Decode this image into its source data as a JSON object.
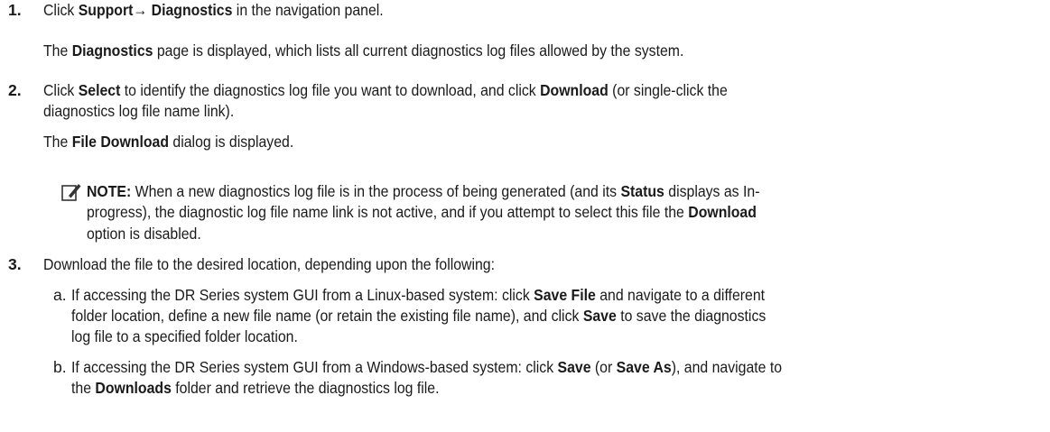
{
  "steps": [
    {
      "number": "1.",
      "line": [
        "Click ",
        "Support",
        "→ ",
        "Diagnostics",
        " in the navigation panel."
      ],
      "result": [
        "The ",
        "Diagnostics",
        " page is displayed, which lists all current diagnostics log files allowed by the system."
      ]
    },
    {
      "number": "2.",
      "line1": [
        "Click ",
        "Select",
        " to identify the diagnostics log file you want to download, and click ",
        "Download",
        " (or single-click the"
      ],
      "line2": "diagnostics log file name link).",
      "result": [
        "The ",
        "File Download",
        " dialog is displayed."
      ]
    },
    {
      "number": "3.",
      "line": "Download the file to the desired location, depending upon the following:"
    }
  ],
  "note": {
    "icon": "note-pencil-icon",
    "label": "NOTE:",
    "line1": [
      " When a new diagnostics log file is in the process of being generated (and its ",
      "Status",
      " displays as In-"
    ],
    "line2": "progress), the diagnostic log file name link is not active, and if you attempt to select this file the ",
    "line2_bold": "Download",
    "line3": "option is disabled."
  },
  "substeps": [
    {
      "letter": "a.",
      "line1": [
        "If accessing the DR Series system GUI from a Linux-based system: click ",
        "Save File",
        " and navigate to a different"
      ],
      "line2": "folder location, define a new file name (or retain the existing file name), and click ",
      "line2_bold": "Save",
      "line2_tail": " to save the diagnostics",
      "line3": "log file to a specified folder location."
    },
    {
      "letter": "b.",
      "line1": [
        "If accessing the DR Series system GUI from a Windows-based system: click ",
        "Save",
        " (or ",
        "Save As",
        "), and navigate to"
      ],
      "line2": [
        "the ",
        "Downloads",
        " folder and retrieve the diagnostics log file."
      ]
    }
  ]
}
